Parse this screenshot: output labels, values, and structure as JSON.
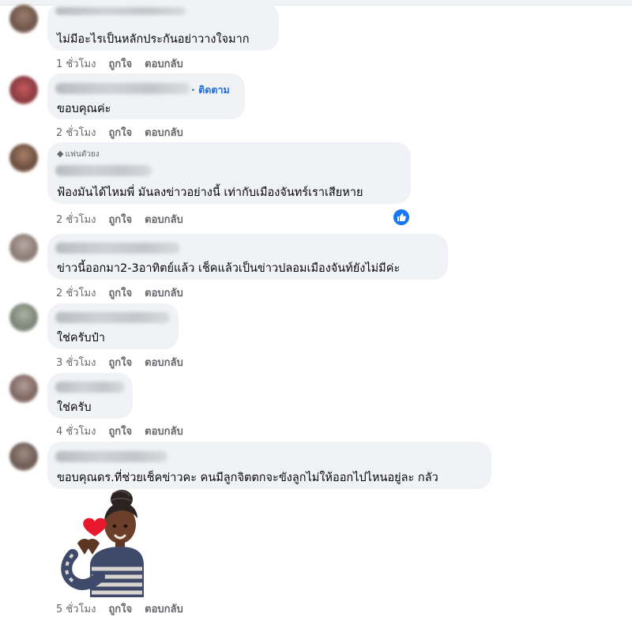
{
  "comments": [
    {
      "text": "ไม่มีอะไรเป็นหลักประกันอย่าวางใจมาก",
      "time": "1 ชั่วโมง"
    },
    {
      "text": "ขอบคุณค่ะ",
      "time": "2 ชั่วโมง",
      "follow": "· ติดตาม"
    },
    {
      "text": "ฟ้องมันได้ไหมพี่ มันลงข่าวอย่างนี้ เท่ากับเมืองจันทร์เราเสียหาย",
      "time": "2 ชั่วโมง",
      "badge": "แฟนตัวยง"
    },
    {
      "text": "ข่าวนี้ออกมา2-3อาทิตย์แล้ว เช็คแล้วเป็นข่าวปลอมเมืองจันท์ยังไม่มีค่ะ",
      "time": "2 ชั่วโมง"
    },
    {
      "text": "ใช่ครับป๋า",
      "time": "3 ชั่วโมง"
    },
    {
      "text": "ใช่ครับ",
      "time": "4 ชั่วโมง"
    },
    {
      "text": "ขอบคุณดร.ที่ช่วยเช็คข่าวคะ คนมีลูกจิตตกจะขังลูกไม่ให้ออกไปไหนอยู่ละ กลัว",
      "time": "5 ชั่วโมง"
    }
  ],
  "actions": {
    "like": "ถูกใจ",
    "reply": "ตอบกลับ"
  },
  "icons": {
    "reaction": "like-reaction-icon",
    "badge": "diamond-icon",
    "sticker": "heart-sticker"
  },
  "colors": {
    "bubble": "#f0f2f5",
    "link": "#216fdb",
    "meta": "#65676b",
    "like_blue": "#1877f2"
  }
}
